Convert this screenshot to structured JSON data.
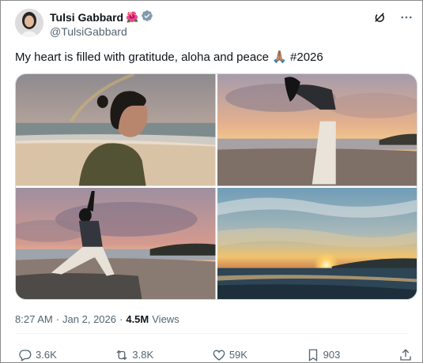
{
  "author": {
    "name": "Tulsi Gabbard",
    "name_emoji": "🌺",
    "handle": "@TulsiGabbard",
    "verified_badge": "gray-checkmark-badge"
  },
  "header_icons": [
    "grok-icon",
    "more-icon"
  ],
  "post": {
    "text": "My heart is filled with gratitude, aloha and peace 🙏🏽 #2026"
  },
  "media": [
    {
      "name": "photo-woman-profile-beach"
    },
    {
      "name": "photo-backbend-sunset"
    },
    {
      "name": "photo-warrior-pose-sunset"
    },
    {
      "name": "photo-ocean-sunset"
    }
  ],
  "meta": {
    "time": "8:27 AM",
    "separator": "·",
    "date": "Jan 2, 2026",
    "separator2": "·",
    "views_count": "4.5M",
    "views_label": "Views"
  },
  "actions": {
    "replies": "3.6K",
    "reposts": "3.8K",
    "likes": "59K",
    "bookmarks": "903"
  },
  "colors": {
    "text": "#0f1419",
    "secondary": "#536471",
    "border": "#cfd9de"
  }
}
